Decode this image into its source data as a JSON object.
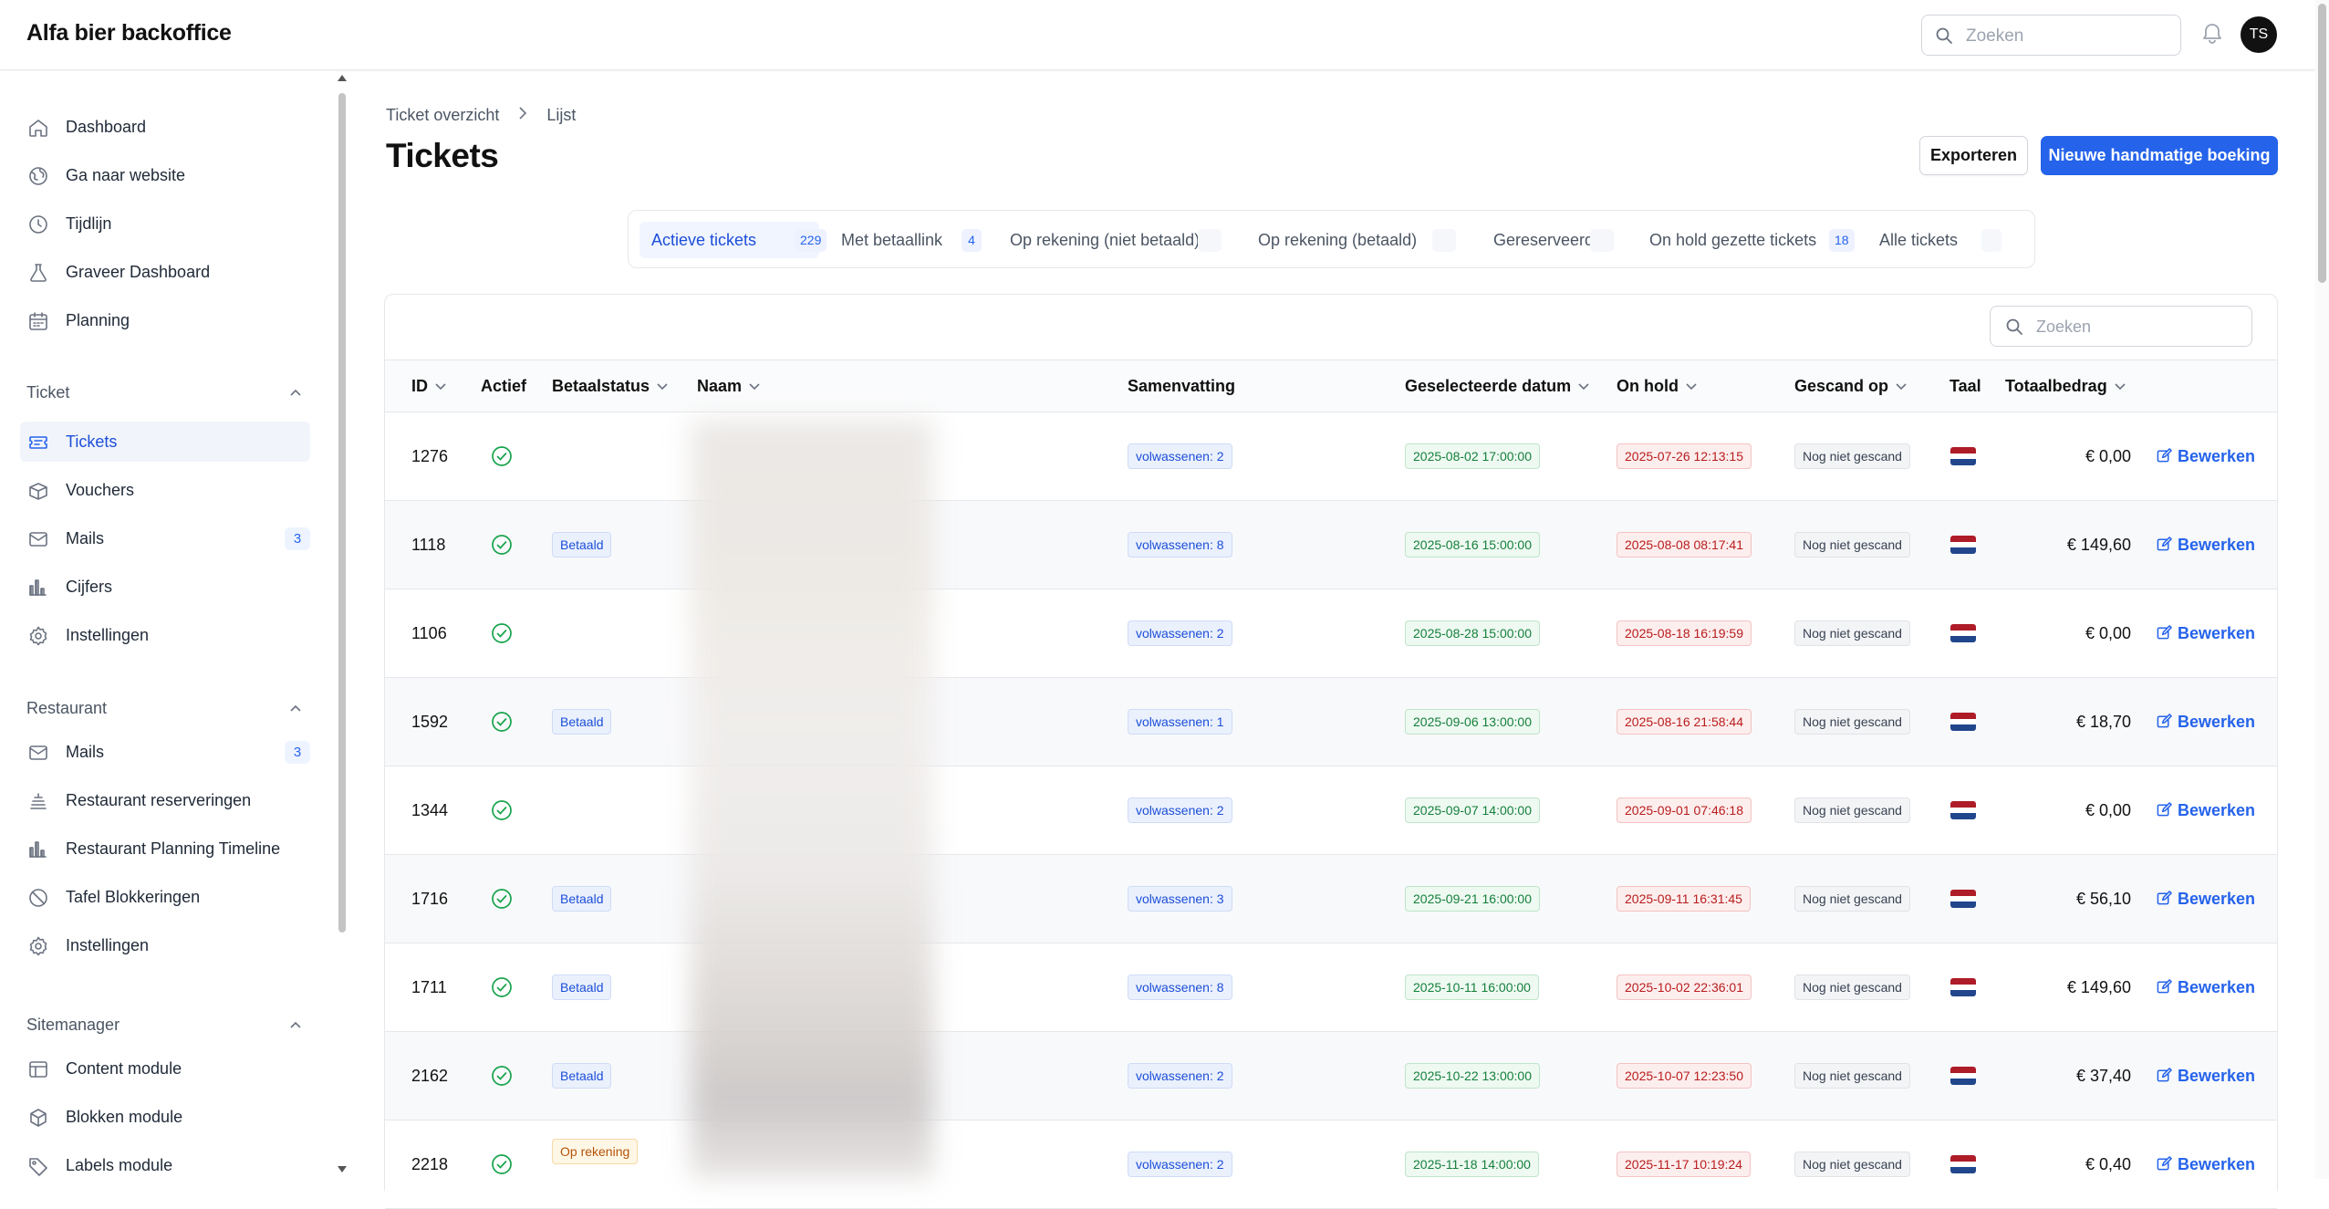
{
  "app": {
    "title": "Alfa bier backoffice",
    "search_placeholder": "Zoeken",
    "avatar_initials": "TS"
  },
  "sidebar": {
    "main": [
      {
        "label": "Dashboard",
        "icon": "home-icon"
      },
      {
        "label": "Ga naar website",
        "icon": "globe-icon"
      },
      {
        "label": "Tijdlijn",
        "icon": "clock-icon"
      },
      {
        "label": "Graveer Dashboard",
        "icon": "flask-icon"
      },
      {
        "label": "Planning",
        "icon": "calendar-icon"
      }
    ],
    "ticket_section": "Ticket",
    "ticket_items": [
      {
        "label": "Tickets",
        "icon": "ticket-icon",
        "active": true
      },
      {
        "label": "Vouchers",
        "icon": "box-icon"
      },
      {
        "label": "Mails",
        "icon": "mail-icon",
        "count": "3"
      },
      {
        "label": "Cijfers",
        "icon": "bar-chart-icon"
      },
      {
        "label": "Instellingen",
        "icon": "gear-icon"
      }
    ],
    "restaurant_section": "Restaurant",
    "restaurant_items": [
      {
        "label": "Mails",
        "icon": "mail-icon",
        "count": "3"
      },
      {
        "label": "Restaurant reserveringen",
        "icon": "stack-icon"
      },
      {
        "label": "Restaurant Planning Timeline",
        "icon": "bar-chart-icon"
      },
      {
        "label": "Tafel Blokkeringen",
        "icon": "block-icon"
      },
      {
        "label": "Instellingen",
        "icon": "gear-icon"
      }
    ],
    "sitemanager_section": "Sitemanager",
    "sitemanager_items": [
      {
        "label": "Content module",
        "icon": "layout-icon"
      },
      {
        "label": "Blokken module",
        "icon": "cube-icon"
      },
      {
        "label": "Labels module",
        "icon": "tag-icon"
      }
    ]
  },
  "breadcrumb": {
    "root": "Ticket overzicht",
    "current": "Lijst"
  },
  "page": {
    "title": "Tickets",
    "export_label": "Exporteren",
    "new_label": "Nieuwe handmatige boeking"
  },
  "tabs": [
    {
      "label": "Actieve tickets",
      "count": "229",
      "active": true
    },
    {
      "label": "Met betaallink",
      "count": "4"
    },
    {
      "label": "Op rekening (niet betaald)",
      "count": ""
    },
    {
      "label": "Op rekening (betaald)",
      "count": ""
    },
    {
      "label": "Gereserveerd",
      "count": ""
    },
    {
      "label": "On hold gezette tickets",
      "count": "18"
    },
    {
      "label": "Alle tickets",
      "count": ""
    }
  ],
  "table": {
    "search_placeholder": "Zoeken",
    "columns": [
      "ID",
      "Actief",
      "Betaalstatus",
      "Naam",
      "Samenvatting",
      "Geselecteerde datum",
      "On hold",
      "Gescand op",
      "Taal",
      "Totaalbedrag"
    ],
    "edit_label": "Bewerken",
    "rows": [
      {
        "id": "1276",
        "status": "",
        "summary": "volwassenen: 2",
        "date": "2025-08-02 17:00:00",
        "hold": "2025-07-26 12:13:15",
        "scanned": "Nog niet gescand",
        "amount": "€ 0,00"
      },
      {
        "id": "1118",
        "status": "Betaald",
        "summary": "volwassenen: 8",
        "date": "2025-08-16 15:00:00",
        "hold": "2025-08-08 08:17:41",
        "scanned": "Nog niet gescand",
        "amount": "€ 149,60"
      },
      {
        "id": "1106",
        "status": "",
        "summary": "volwassenen: 2",
        "date": "2025-08-28 15:00:00",
        "hold": "2025-08-18 16:19:59",
        "scanned": "Nog niet gescand",
        "amount": "€ 0,00"
      },
      {
        "id": "1592",
        "status": "Betaald",
        "summary": "volwassenen: 1",
        "date": "2025-09-06 13:00:00",
        "hold": "2025-08-16 21:58:44",
        "scanned": "Nog niet gescand",
        "amount": "€ 18,70"
      },
      {
        "id": "1344",
        "status": "",
        "summary": "volwassenen: 2",
        "date": "2025-09-07 14:00:00",
        "hold": "2025-09-01 07:46:18",
        "scanned": "Nog niet gescand",
        "amount": "€ 0,00"
      },
      {
        "id": "1716",
        "status": "Betaald",
        "summary": "volwassenen: 3",
        "date": "2025-09-21 16:00:00",
        "hold": "2025-09-11 16:31:45",
        "scanned": "Nog niet gescand",
        "amount": "€ 56,10"
      },
      {
        "id": "1711",
        "status": "Betaald",
        "summary": "volwassenen: 8",
        "date": "2025-10-11 16:00:00",
        "hold": "2025-10-02 22:36:01",
        "scanned": "Nog niet gescand",
        "amount": "€ 149,60"
      },
      {
        "id": "2162",
        "status": "Betaald",
        "summary": "volwassenen: 2",
        "date": "2025-10-22 13:00:00",
        "hold": "2025-10-07 12:23:50",
        "scanned": "Nog niet gescand",
        "amount": "€ 37,40"
      },
      {
        "id": "2218",
        "status": "Op rekening",
        "summary": "volwassenen: 2",
        "date": "2025-11-18 14:00:00",
        "hold": "2025-11-17 10:19:24",
        "scanned": "Nog niet gescand",
        "amount": "€ 0,40"
      }
    ]
  },
  "colors": {
    "accent": "#2563eb",
    "check_green": "#16a34a",
    "flag": [
      "#ae1c28",
      "#ffffff",
      "#21468b"
    ]
  }
}
